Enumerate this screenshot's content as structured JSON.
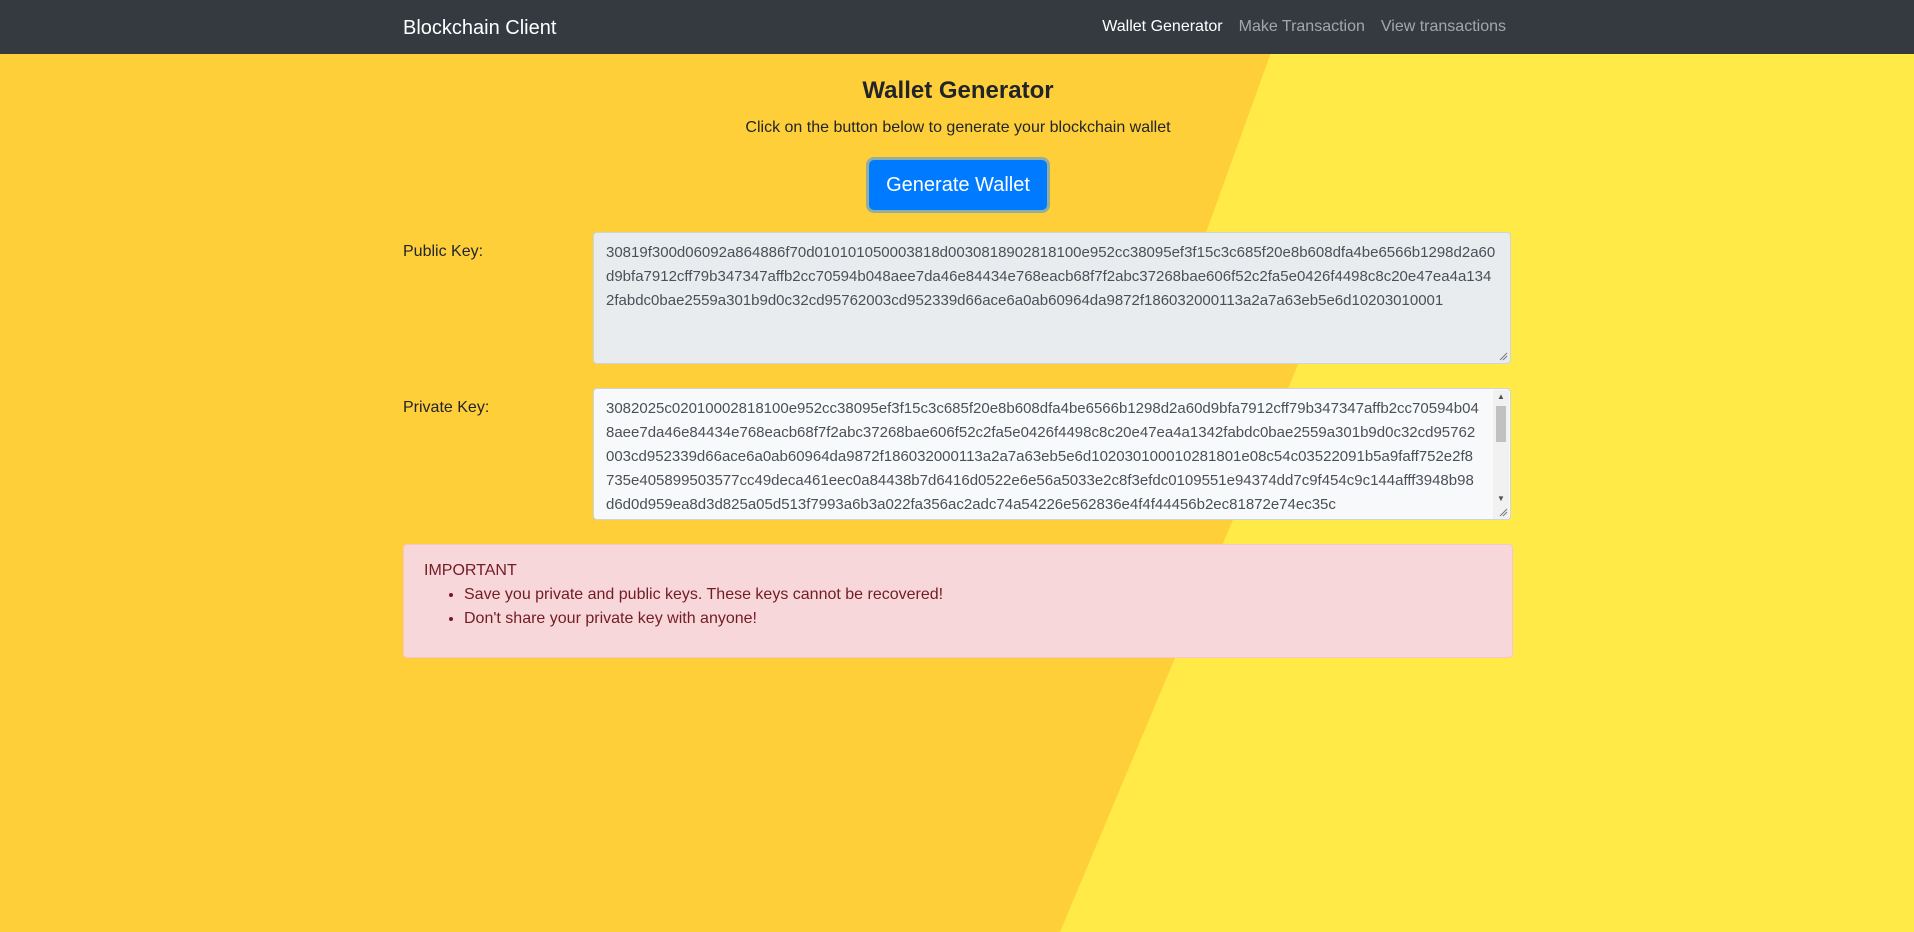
{
  "colors": {
    "background_left": "#ffcf3a",
    "background_right": "#ffea47",
    "navbar": "#343a40",
    "primary_button": "#007bff",
    "alert_background": "#f8d7da",
    "alert_text": "#721c24"
  },
  "navbar": {
    "brand": "Blockchain Client",
    "links": [
      {
        "label": "Wallet Generator",
        "active": true
      },
      {
        "label": "Make Transaction",
        "active": false
      },
      {
        "label": "View transactions",
        "active": false
      }
    ]
  },
  "main": {
    "title": "Wallet Generator",
    "subtitle": "Click on the button below to generate your blockchain wallet",
    "generate_button": "Generate Wallet",
    "public_key": {
      "label": "Public Key:",
      "value": "30819f300d06092a864886f70d010101050003818d0030818902818100e952cc38095ef3f15c3c685f20e8b608dfa4be6566b1298d2a60d9bfa7912cff79b347347affb2cc70594b048aee7da46e84434e768eacb68f7f2abc37268bae606f52c2fa5e0426f4498c8c20e47ea4a1342fabdc0bae2559a301b9d0c32cd95762003cd952339d66ace6a0ab60964da9872f186032000113a2a7a63eb5e6d10203010001"
    },
    "private_key": {
      "label": "Private Key:",
      "value": "3082025c02010002818100e952cc38095ef3f15c3c685f20e8b608dfa4be6566b1298d2a60d9bfa7912cff79b347347affb2cc70594b048aee7da46e84434e768eacb68f7f2abc37268bae606f52c2fa5e0426f4498c8c20e47ea4a1342fabdc0bae2559a301b9d0c32cd95762003cd952339d66ace6a0ab60964da9872f186032000113a2a7a63eb5e6d102030100010281801e08c54c03522091b5a9faff752e2f8735e405899503577cc49deca461eec0a84438b7d6416d0522e6e56a5033e2c8f3efdc0109551e94374dd7c9f454c9c144afff3948b98d6d0d959ea8d3d825a05d513f7993a6b3a022fa356ac2adc74a54226e562836e4f4f44456b2ec81872e74ec35c"
    },
    "alert": {
      "heading": "IMPORTANT",
      "items": [
        "Save you private and public keys. These keys cannot be recovered!",
        "Don't share your private key with anyone!"
      ]
    }
  }
}
